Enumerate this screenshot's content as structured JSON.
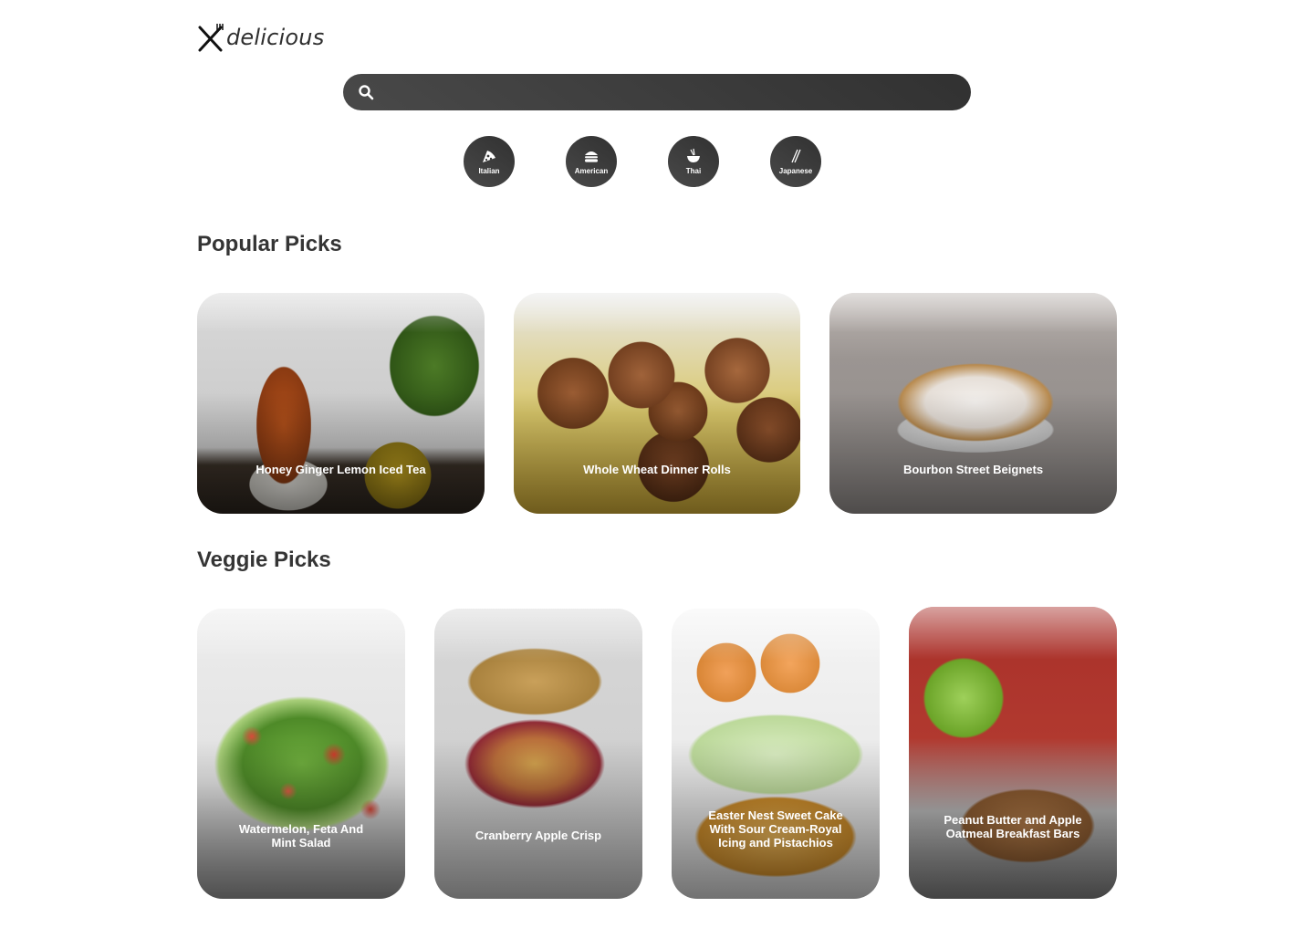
{
  "brand": {
    "name": "delicious"
  },
  "search": {
    "value": "",
    "placeholder": ""
  },
  "categories": [
    {
      "label": "Italian",
      "icon": "pizza-icon"
    },
    {
      "label": "American",
      "icon": "burger-icon"
    },
    {
      "label": "Thai",
      "icon": "noodle-bowl-icon"
    },
    {
      "label": "Japanese",
      "icon": "chopsticks-icon"
    }
  ],
  "popular": {
    "title": "Popular Picks",
    "items": [
      {
        "title": "Honey Ginger Lemon Iced Tea"
      },
      {
        "title": "Whole Wheat Dinner Rolls"
      },
      {
        "title": "Bourbon Street Beignets"
      }
    ]
  },
  "veggie": {
    "title": "Veggie Picks",
    "items": [
      {
        "title": "Watermelon, Feta And Mint Salad"
      },
      {
        "title": "Cranberry Apple Crisp"
      },
      {
        "title": "Easter Nest Sweet Cake With Sour Cream-Royal Icing and Pistachios"
      },
      {
        "title": "Peanut Butter and Apple Oatmeal Breakfast Bars"
      }
    ]
  },
  "colors": {
    "accent_dark": "#313131",
    "accent_light": "#494949",
    "text": "#353535",
    "background": "#ffffff"
  }
}
